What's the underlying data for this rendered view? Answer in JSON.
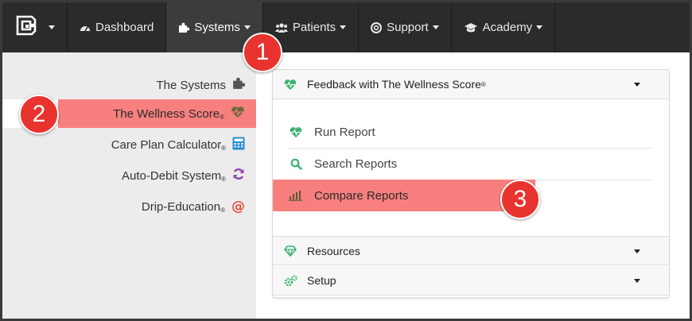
{
  "nav": {
    "items": [
      {
        "label": "Dashboard",
        "icon": "dashboard-icon"
      },
      {
        "label": "Systems",
        "icon": "puzzle-icon"
      },
      {
        "label": "Patients",
        "icon": "users-icon"
      },
      {
        "label": "Support",
        "icon": "lifebuoy-icon"
      },
      {
        "label": "Academy",
        "icon": "graduation-cap-icon"
      }
    ],
    "active": "Systems"
  },
  "sidebar": {
    "items": [
      {
        "label": "The Systems",
        "mark": "",
        "icon": "puzzle-icon"
      },
      {
        "label": "The Wellness Score",
        "mark": "®",
        "icon": "heart-pulse-icon"
      },
      {
        "label": "Care Plan Calculator",
        "mark": "®",
        "icon": "calculator-icon"
      },
      {
        "label": "Auto-Debit System",
        "mark": "®",
        "icon": "refresh-icon"
      },
      {
        "label": "Drip-Education",
        "mark": "®",
        "icon": "at-icon"
      }
    ],
    "selected": "The Wellness Score"
  },
  "panel": {
    "feedback": {
      "title": "Feedback with The Wellness Score",
      "mark": "®"
    },
    "subitems": [
      {
        "label": "Run Report",
        "icon": "heart-pulse-icon"
      },
      {
        "label": "Search Reports",
        "icon": "search-icon"
      },
      {
        "label": "Compare Reports",
        "icon": "bar-chart-icon"
      }
    ],
    "resources": "Resources",
    "setup": "Setup"
  },
  "badges": [
    "1",
    "2",
    "3"
  ],
  "colors": {
    "navbar": "#2b2b2b",
    "highlight": "#f7807f",
    "badge": "#e8332e",
    "green": "#3cb371",
    "calculator": "#2b8bd6",
    "refresh": "#8e44ad",
    "at": "#e74c3c"
  }
}
